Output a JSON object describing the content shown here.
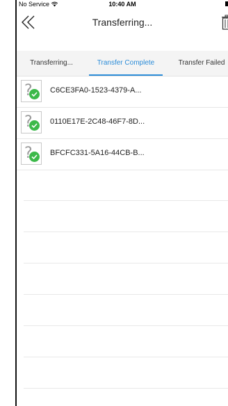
{
  "status_bar": {
    "carrier": "No Service",
    "time": "10:40 AM"
  },
  "nav": {
    "title": "Transferring...",
    "back_icon": "double-chevron-left-icon",
    "trash_icon": "trash-icon"
  },
  "tabs": [
    {
      "label": "Transferring...",
      "active": false
    },
    {
      "label": "Transfer Complete",
      "active": true
    },
    {
      "label": "Transfer Failed",
      "active": false
    }
  ],
  "files": [
    {
      "name": "C6CE3FA0-1523-4379-A...",
      "status_icon": "check-icon"
    },
    {
      "name": "0110E17E-2C48-46F7-8D...",
      "status_icon": "check-icon"
    },
    {
      "name": "BFCFC331-5A16-44CB-B...",
      "status_icon": "check-icon"
    }
  ],
  "colors": {
    "accent": "#2b8cd8",
    "success": "#3cb94a",
    "tab_bar_bg": "#f4f4f4"
  }
}
